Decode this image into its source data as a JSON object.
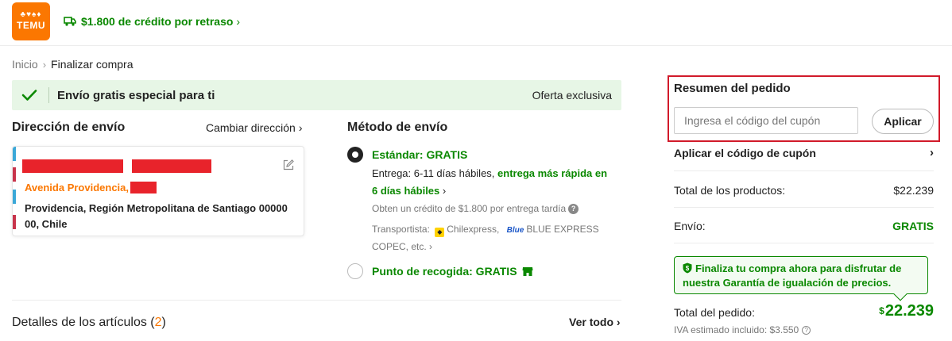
{
  "header": {
    "logo_text": "TEMU",
    "logo_glyphs": "♣♥♠♦",
    "credit_banner": "$1.800 de crédito por retraso",
    "credit_chevron": "›"
  },
  "breadcrumb": {
    "home": "Inicio",
    "separator": "›",
    "current": "Finalizar compra"
  },
  "promo": {
    "title": "Envío gratis especial para ti",
    "badge": "Oferta exclusiva"
  },
  "shipping_address": {
    "title": "Dirección de envío",
    "change_label": "Cambiar dirección",
    "change_chevron": "›",
    "street": "Avenida Providencia,",
    "city_line": "Providencia, Región Metropolitana de Santiago 00000 00, Chile"
  },
  "shipping_method": {
    "title": "Método de envío",
    "standard_title": "Estándar: GRATIS",
    "delivery_prefix": "Entrega: 6-11 días hábiles,",
    "delivery_fast": "entrega más rápida en 6 días hábiles",
    "delivery_chevron": "›",
    "late_credit": "Obten un crédito de $1.800 por entrega tardía",
    "carriers_prefix": "Transportista:",
    "carrier_1": "Chilexpress,",
    "carrier_2_logo": "Blue",
    "carrier_2": "BLUE EXPRESS",
    "carriers_suffix": "COPEC,  etc.",
    "carriers_chevron": "›",
    "pickup_title": "Punto de recogida: GRATIS"
  },
  "items": {
    "title": "Detalles de los artículos",
    "count": "2",
    "view_all": "Ver todo",
    "view_all_chevron": "›"
  },
  "summary": {
    "title": "Resumen del pedido",
    "coupon_placeholder": "Ingresa el código del cupón",
    "apply_button": "Aplicar",
    "apply_coupon_row": "Aplicar el código de cupón",
    "apply_coupon_chevron": "›",
    "products_label": "Total de los productos:",
    "products_value": "$22.239",
    "shipping_label": "Envío:",
    "shipping_value": "GRATIS",
    "guarantee_text": "Finaliza tu compra ahora para disfrutar de nuestra Garantía de igualación de precios.",
    "total_label": "Total del pedido:",
    "total_currency": "$",
    "total_value": "22.239",
    "iva_text": "IVA estimado incluido: $3.550"
  },
  "colors": {
    "brand_orange": "#fb7701",
    "success_green": "#0a8800",
    "highlight_red": "#d11a2a",
    "promo_bg": "#e7f6e6"
  },
  "icons": [
    "truck-icon",
    "check-icon",
    "edit-icon",
    "question-icon",
    "store-icon",
    "shield-icon",
    "chevron-right-icon"
  ]
}
